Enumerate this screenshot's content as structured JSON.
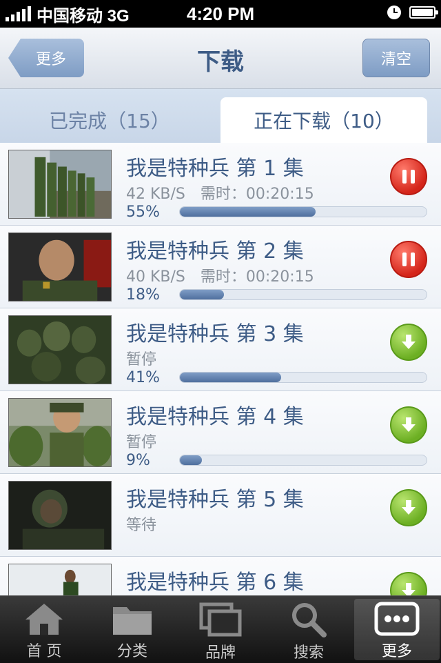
{
  "status_bar": {
    "carrier": "中国移动 3G",
    "time": "4:20 PM"
  },
  "nav": {
    "back_label": "更多",
    "title": "下载",
    "clear_label": "清空"
  },
  "tabs": {
    "completed": "已完成（15）",
    "downloading": "正在下载（10）"
  },
  "downloads": [
    {
      "title": "我是特种兵 第 1 集",
      "speed": "42 KB/S",
      "time_left": "需时：00:20:15",
      "status": "",
      "percent_label": "55%",
      "progress": 0.55,
      "action_icon": "pause-icon"
    },
    {
      "title": "我是特种兵 第 2 集",
      "speed": "40 KB/S",
      "time_left": "需时：00:20:15",
      "status": "",
      "percent_label": "18%",
      "progress": 0.18,
      "action_icon": "pause-icon"
    },
    {
      "title": "我是特种兵 第 3 集",
      "speed": "",
      "time_left": "",
      "status": "暂停",
      "percent_label": "41%",
      "progress": 0.41,
      "action_icon": "download-icon"
    },
    {
      "title": "我是特种兵 第 4 集",
      "speed": "",
      "time_left": "",
      "status": "暂停",
      "percent_label": "9%",
      "progress": 0.09,
      "action_icon": "download-icon"
    },
    {
      "title": "我是特种兵 第 5 集",
      "speed": "",
      "time_left": "",
      "status": "等待",
      "percent_label": "",
      "progress": null,
      "action_icon": "download-icon"
    },
    {
      "title": "我是特种兵 第 6 集",
      "speed": "",
      "time_left": "",
      "status": "",
      "percent_label": "",
      "progress": null,
      "action_icon": "download-icon"
    }
  ],
  "tabbar": {
    "items": [
      {
        "label": "首 页",
        "icon": "home-icon"
      },
      {
        "label": "分类",
        "icon": "folder-icon"
      },
      {
        "label": "品牌",
        "icon": "brand-icon"
      },
      {
        "label": "搜索",
        "icon": "search-icon"
      },
      {
        "label": "更多",
        "icon": "more-icon",
        "active": true
      }
    ]
  },
  "colors": {
    "accent": "#3e5c86",
    "pause": "#d4251a",
    "download": "#6caf23"
  }
}
